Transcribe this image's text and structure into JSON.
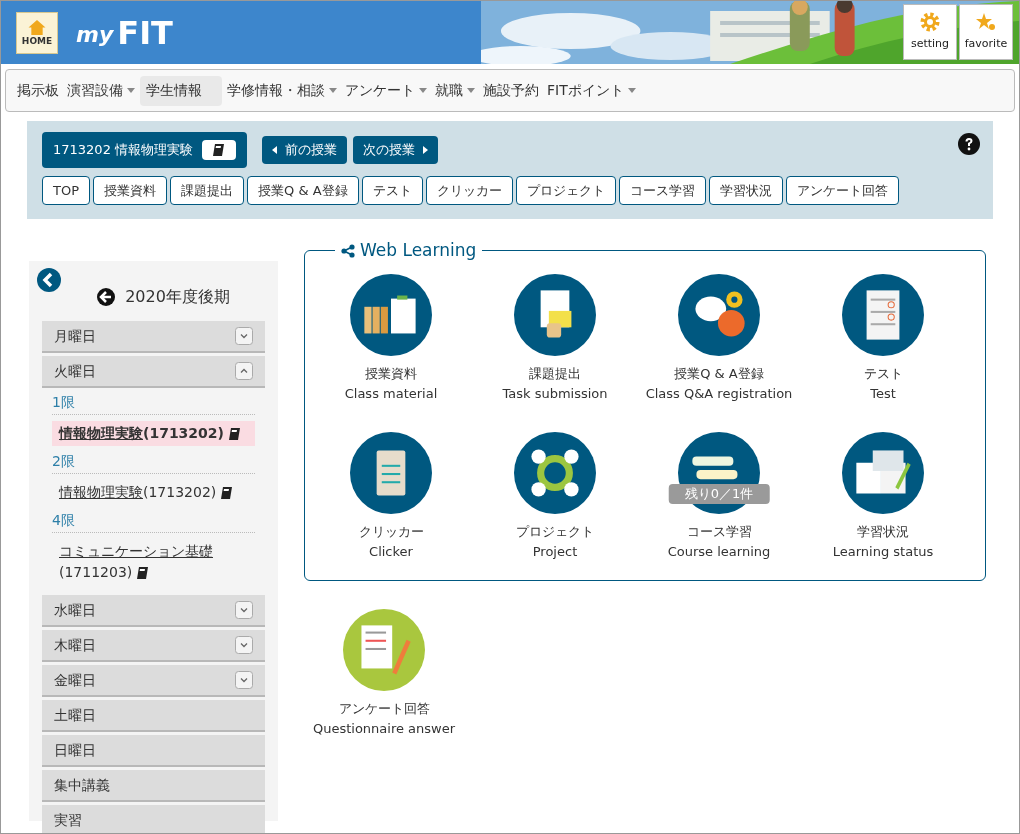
{
  "header": {
    "home_label": "HOME",
    "logo_small": "my",
    "logo_big": "FIT",
    "buttons": [
      {
        "label": "setting",
        "kind": "gear"
      },
      {
        "label": "favorite",
        "kind": "star"
      }
    ]
  },
  "nav": [
    {
      "label": "掲示板",
      "dropdown": false,
      "selected": false
    },
    {
      "label": "演習設備",
      "dropdown": true,
      "selected": false
    },
    {
      "label": "学生情報",
      "dropdown": false,
      "selected": true
    },
    {
      "label": "学修情報・相談",
      "dropdown": true,
      "selected": false
    },
    {
      "label": "アンケート",
      "dropdown": true,
      "selected": false
    },
    {
      "label": "就職",
      "dropdown": true,
      "selected": false
    },
    {
      "label": "施設予約",
      "dropdown": false,
      "selected": false
    },
    {
      "label": "FITポイント",
      "dropdown": true,
      "selected": false
    }
  ],
  "course": {
    "title": "1713202 情報物理実験",
    "prev": "前の授業",
    "next": "次の授業",
    "tabs": [
      "TOP",
      "授業資料",
      "課題提出",
      "授業Q & A登録",
      "テスト",
      "クリッカー",
      "プロジェクト",
      "コース学習",
      "学習状況",
      "アンケート回答"
    ]
  },
  "sidebar": {
    "term": "2020年度後期",
    "days": [
      {
        "label": "月曜日",
        "expandable": true,
        "expanded": false
      },
      {
        "label": "火曜日",
        "expandable": true,
        "expanded": true,
        "periods": [
          {
            "label": "1限",
            "courses": [
              {
                "name": "情報物理実験",
                "code": "(1713202)",
                "selected": true
              }
            ]
          },
          {
            "label": "2限",
            "courses": [
              {
                "name": "情報物理実験",
                "code": "(1713202)",
                "selected": false
              }
            ]
          },
          {
            "label": "4限",
            "courses": [
              {
                "name": "コミュニケーション基礎",
                "code": "(1711203)",
                "selected": false
              }
            ]
          }
        ]
      },
      {
        "label": "水曜日",
        "expandable": true,
        "expanded": false
      },
      {
        "label": "木曜日",
        "expandable": true,
        "expanded": false
      },
      {
        "label": "金曜日",
        "expandable": true,
        "expanded": false
      },
      {
        "label": "土曜日",
        "expandable": false
      },
      {
        "label": "日曜日",
        "expandable": false
      },
      {
        "label": "集中講義",
        "expandable": false
      },
      {
        "label": "実習",
        "expandable": false
      }
    ]
  },
  "web_learning": {
    "title": "Web Learning",
    "items": [
      {
        "kind": "binders",
        "jp": "授業資料",
        "en": "Class material"
      },
      {
        "kind": "clipboard",
        "jp": "課題提出",
        "en": "Task submission"
      },
      {
        "kind": "qa",
        "jp": "授業Q & A登録",
        "en": "Class Q&A registration"
      },
      {
        "kind": "test",
        "jp": "テスト",
        "en": "Test"
      },
      {
        "kind": "keypad",
        "jp": "クリッカー",
        "en": "Clicker"
      },
      {
        "kind": "people",
        "jp": "プロジェクト",
        "en": "Project"
      },
      {
        "kind": "tags",
        "jp": "コース学習",
        "en": "Course learning",
        "badge": "残り0／1件"
      },
      {
        "kind": "notebook",
        "jp": "学習状況",
        "en": "Learning status"
      }
    ]
  },
  "extra_items": [
    {
      "kind": "checklist",
      "jp": "アンケート回答",
      "en": "Questionnaire answer"
    }
  ]
}
